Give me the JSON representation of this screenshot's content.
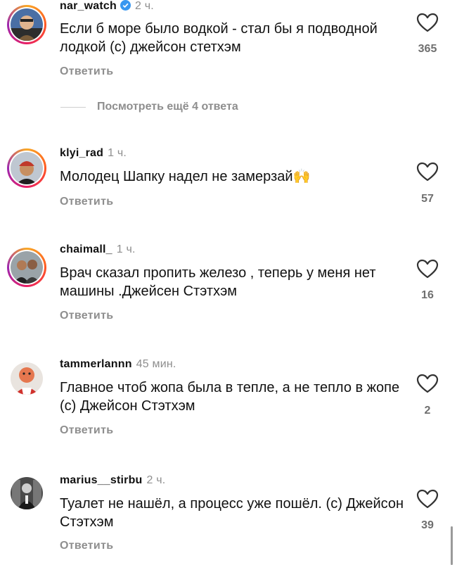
{
  "colors": {
    "muted": "#8e8e8e",
    "verified": "#3897f0",
    "count": "#6f6f6f"
  },
  "view_more_label": "Посмотреть ещё 4 ответа",
  "comments": [
    {
      "username": "nar_watch",
      "verified": true,
      "time": "2 ч.",
      "text": "Если б море было водкой - стал бы я подводной лодкой (с) джейсон стетхэм",
      "likes": "365",
      "reply_label": "Ответить"
    },
    {
      "username": "klyi_rad",
      "verified": false,
      "time": "1 ч.",
      "text": "Молодец Шапку надел не замерзай🙌",
      "likes": "57",
      "reply_label": "Ответить"
    },
    {
      "username": "chaimall_",
      "verified": false,
      "time": "1 ч.",
      "text": "Врач сказал пропить железо , теперь у меня нет машины .Джейсен Стэтхэм",
      "likes": "16",
      "reply_label": "Ответить"
    },
    {
      "username": "tammerlannn",
      "verified": false,
      "time": "45 мин.",
      "text": "Главное чтоб жопа была в тепле, а не тепло в жопе (с) Джейсон Стэтхэм",
      "likes": "2",
      "reply_label": "Ответить"
    },
    {
      "username": "marius__stirbu",
      "verified": false,
      "time": "2 ч.",
      "text": "Туалет не нашёл, а процесс уже пошёл. (с) Джейсон Стэтхэм",
      "likes": "39",
      "reply_label": "Ответить"
    }
  ]
}
